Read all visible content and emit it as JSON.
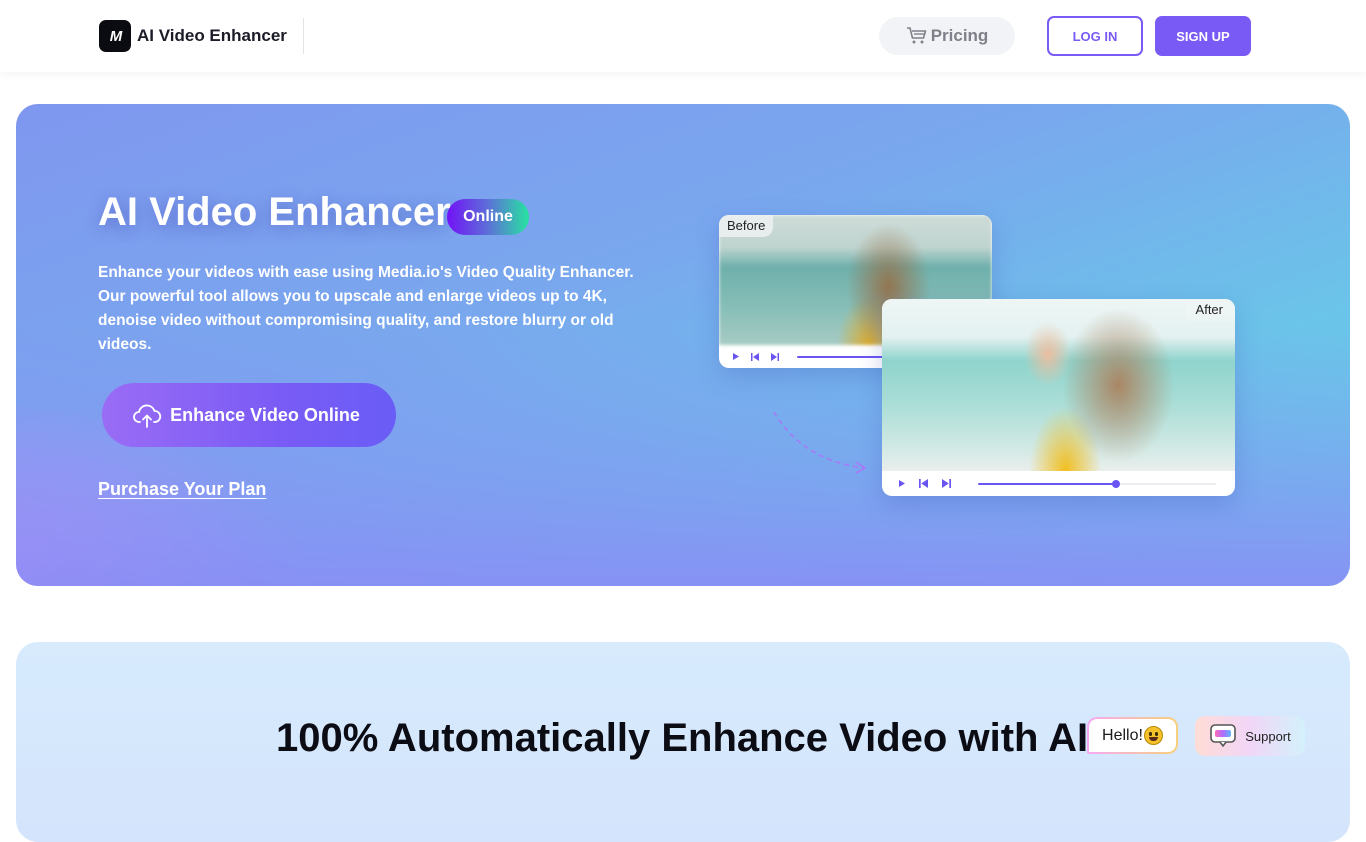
{
  "header": {
    "logo_text": "M",
    "brand": "AI Video Enhancer",
    "pricing_label": "Pricing",
    "login_label": "LOG IN",
    "signup_label": "SIGN UP"
  },
  "hero": {
    "title": "AI Video Enhancer",
    "badge": "Online",
    "description": "Enhance your videos with ease using Media.io's Video Quality Enhancer. Our powerful tool allows you to upscale and enlarge videos up to 4K, denoise video without compromising quality, and restore blurry or old videos.",
    "cta_label": "Enhance Video Online",
    "purchase_link": "Purchase Your Plan",
    "before_card": {
      "label": "Before",
      "progress": 1.0
    },
    "after_card": {
      "label": "After",
      "progress": 0.58
    }
  },
  "section2": {
    "title": "100% Automatically Enhance Video with AI"
  },
  "widgets": {
    "hello_label": "Hello!",
    "support_label": "Support"
  },
  "colors": {
    "accent": "#7a5af5",
    "player_accent": "#6956f2",
    "badge_start": "#7212f6",
    "badge_end": "#27e3a0"
  }
}
